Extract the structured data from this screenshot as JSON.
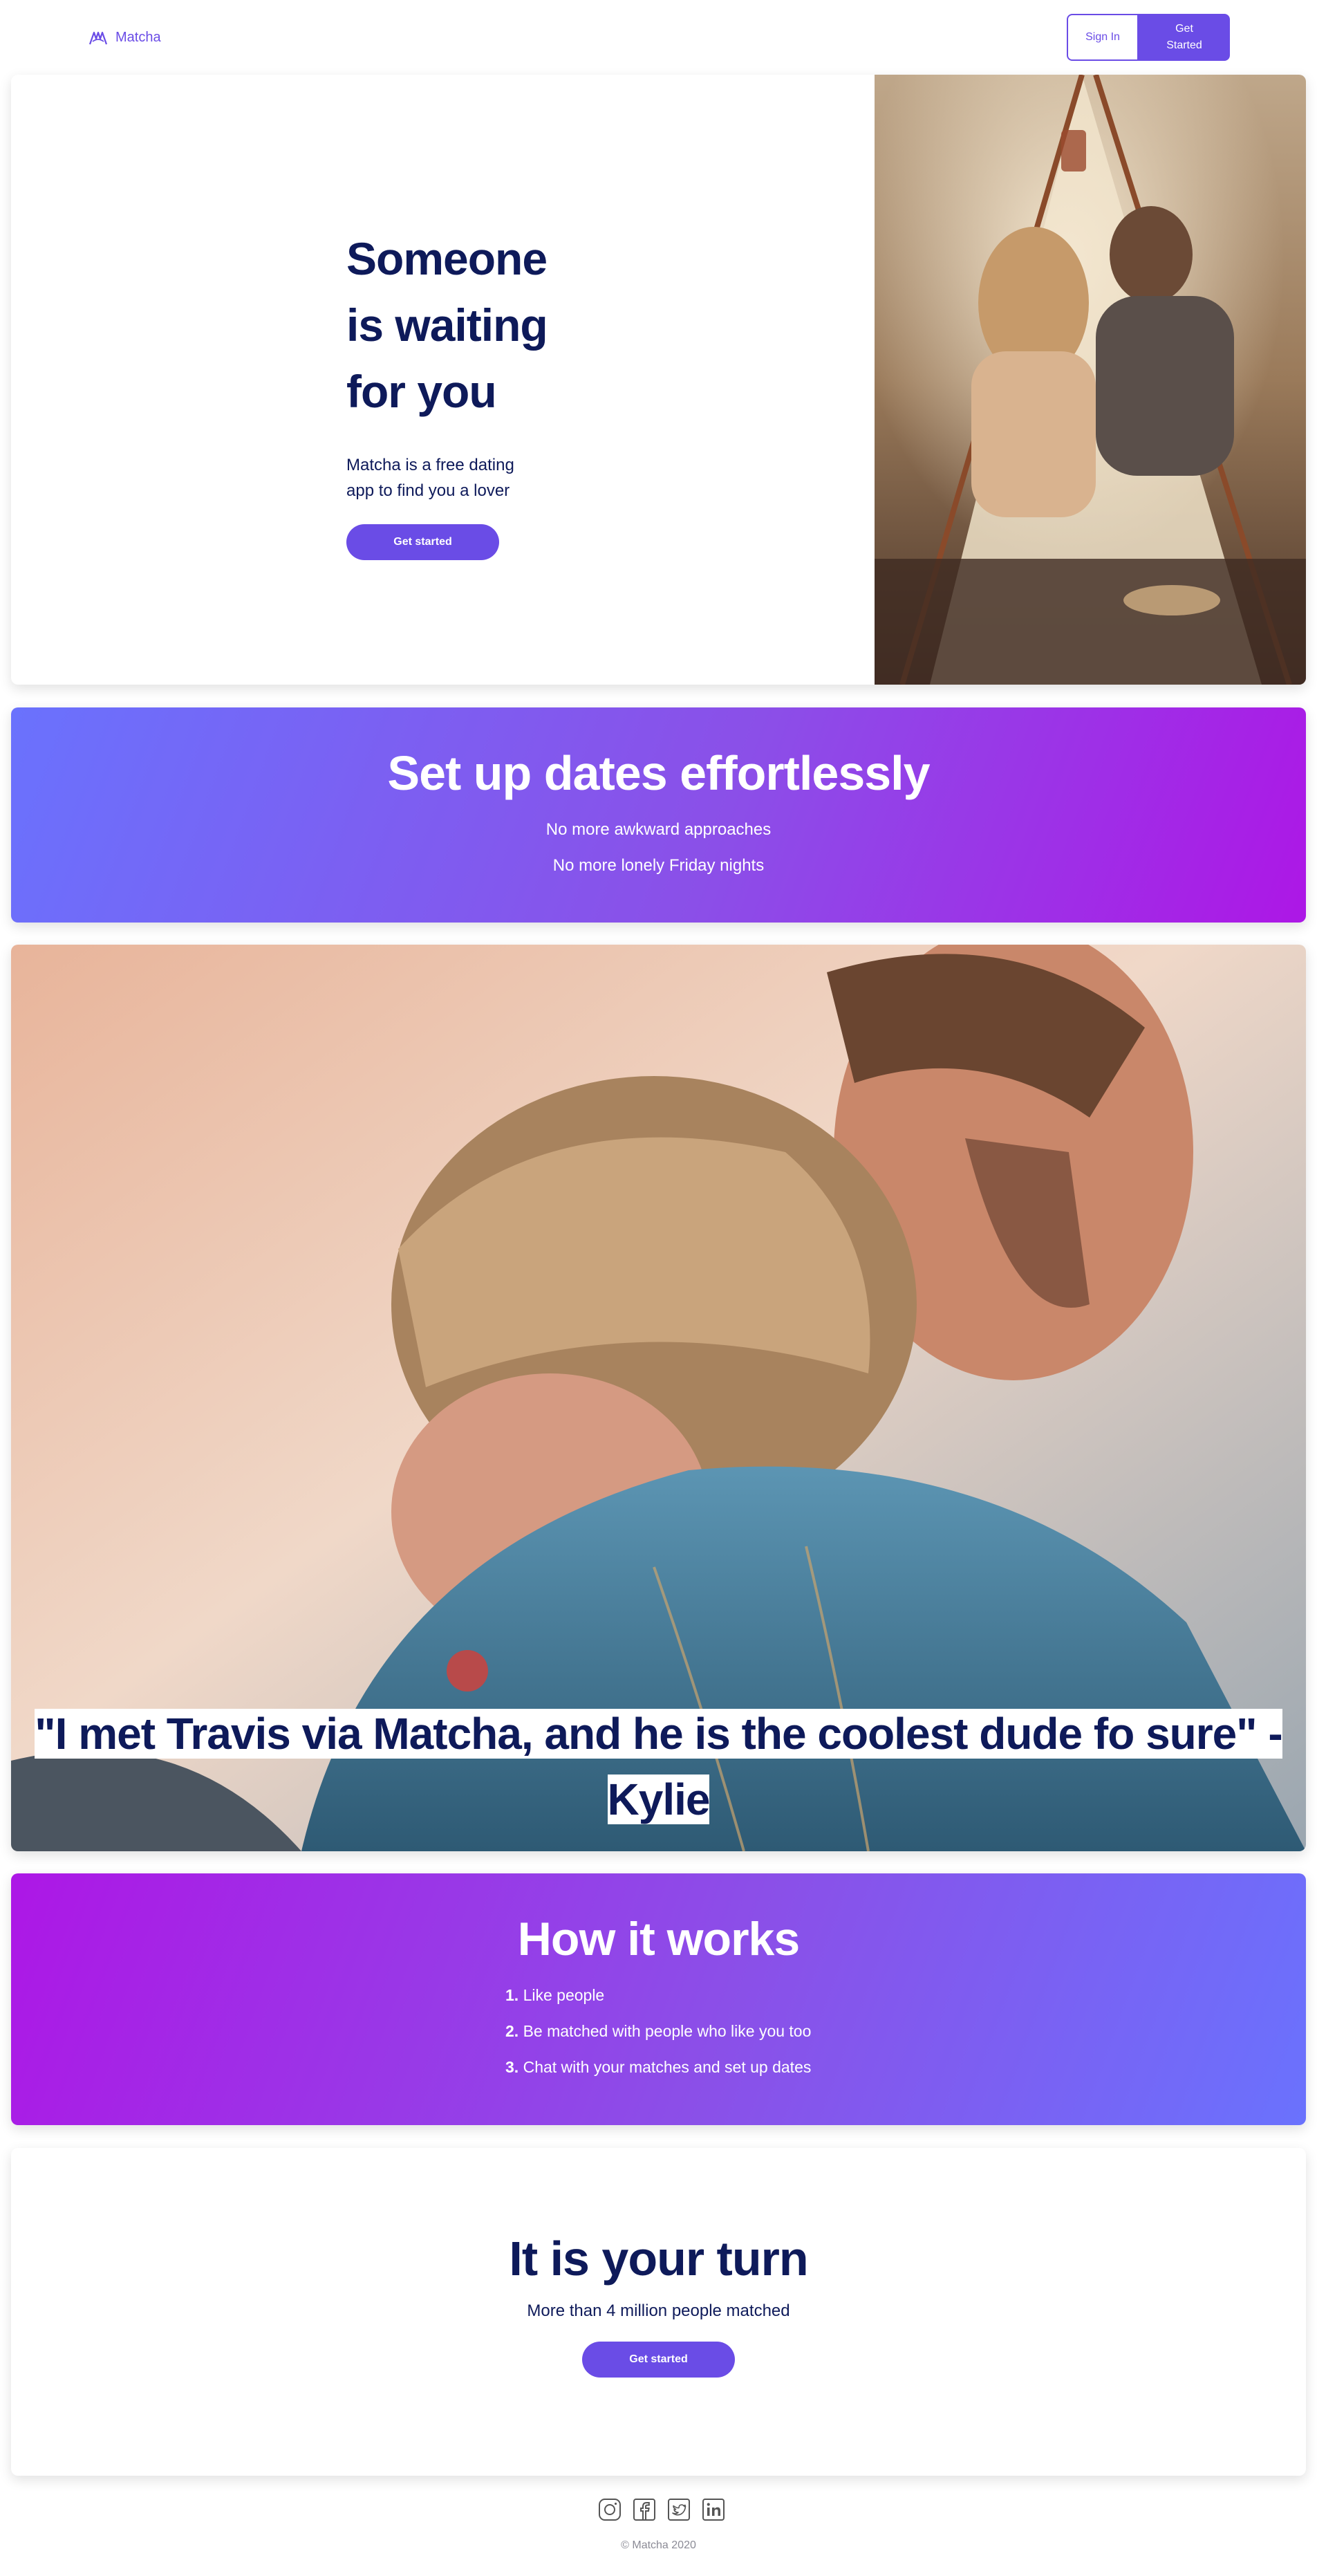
{
  "header": {
    "brand": "Matcha",
    "sign_in": "Sign In",
    "get_started": "Get Started"
  },
  "hero": {
    "title_lines": [
      "Someone",
      "is waiting",
      "for you"
    ],
    "subtitle": "Matcha is a free dating app to find you a lover",
    "cta": "Get started"
  },
  "features": {
    "title": "Set up dates effortlessly",
    "lines": [
      "No more awkward approaches",
      "No more lonely Friday nights"
    ]
  },
  "testimonial": {
    "quote": "\"I met Travis via Matcha, and he is the coolest dude fo sure\" - Kylie"
  },
  "how_it_works": {
    "title": "How it works",
    "steps": [
      {
        "num": "1.",
        "text": "Like people"
      },
      {
        "num": "2.",
        "text": "Be matched with people who like you too"
      },
      {
        "num": "3.",
        "text": "Chat with your matches and set up dates"
      }
    ]
  },
  "cta_section": {
    "title": "It is your turn",
    "subtitle": "More than 4 million people matched",
    "cta": "Get started"
  },
  "footer": {
    "social_icons": [
      "instagram-icon",
      "facebook-icon",
      "twitter-icon",
      "linkedin-icon"
    ],
    "copyright": "© Matcha 2020"
  },
  "colors": {
    "accent": "#6a4ce6",
    "heading": "#0e1a5a",
    "gradient_start": "#6a72fd",
    "gradient_end": "#ad17e6"
  }
}
